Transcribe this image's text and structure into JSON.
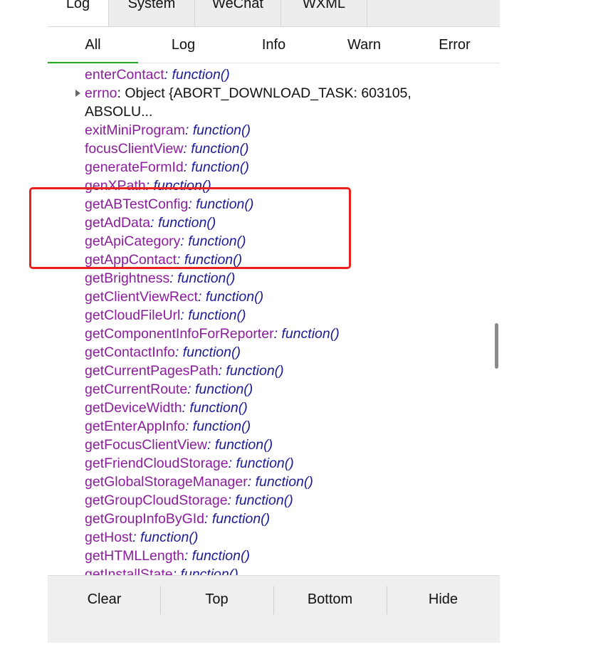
{
  "tabs": [
    "Log",
    "System",
    "WeChat",
    "WXML"
  ],
  "filters": [
    "All",
    "Log",
    "Info",
    "Warn",
    "Error"
  ],
  "log_entries": [
    {
      "key": "enterContact",
      "val": ": function()"
    },
    {
      "key": "errno",
      "val": ": Object {ABORT_DOWNLOAD_TASK: 603105,",
      "expandable": true
    },
    {
      "key": "",
      "val": "ABSOLU..."
    },
    {
      "key": "exitMiniProgram",
      "val": ": function()"
    },
    {
      "key": "focusClientView",
      "val": ": function()"
    },
    {
      "key": "generateFormId",
      "val": ": function()"
    },
    {
      "key": "genXPath",
      "val": ": function()"
    },
    {
      "key": "getABTestConfig",
      "val": ": function()"
    },
    {
      "key": "getAdData",
      "val": ": function()"
    },
    {
      "key": "getApiCategory",
      "val": ": function()"
    },
    {
      "key": "getAppContact",
      "val": ": function()"
    },
    {
      "key": "getBrightness",
      "val": ": function()"
    },
    {
      "key": "getClientViewRect",
      "val": ": function()"
    },
    {
      "key": "getCloudFileUrl",
      "val": ": function()"
    },
    {
      "key": "getComponentInfoForReporter",
      "val": ": function()"
    },
    {
      "key": "getContactInfo",
      "val": ": function()"
    },
    {
      "key": "getCurrentPagesPath",
      "val": ": function()"
    },
    {
      "key": "getCurrentRoute",
      "val": ": function()"
    },
    {
      "key": "getDeviceWidth",
      "val": ": function()"
    },
    {
      "key": "getEnterAppInfo",
      "val": ": function()"
    },
    {
      "key": "getFocusClientView",
      "val": ": function()"
    },
    {
      "key": "getFriendCloudStorage",
      "val": ": function()"
    },
    {
      "key": "getGlobalStorageManager",
      "val": ": function()"
    },
    {
      "key": "getGroupCloudStorage",
      "val": ": function()"
    },
    {
      "key": "getGroupInfoByGId",
      "val": ": function()"
    },
    {
      "key": "getHost",
      "val": ": function()"
    },
    {
      "key": "getHTMLLength",
      "val": ": function()"
    },
    {
      "key": "getInstallState",
      "val": ": function()"
    }
  ],
  "bottom_buttons": [
    "Clear",
    "Top",
    "Bottom",
    "Hide"
  ],
  "colors": {
    "key": "#8b1c9b",
    "value": "#1b1a96",
    "highlight": "#e8201f"
  }
}
